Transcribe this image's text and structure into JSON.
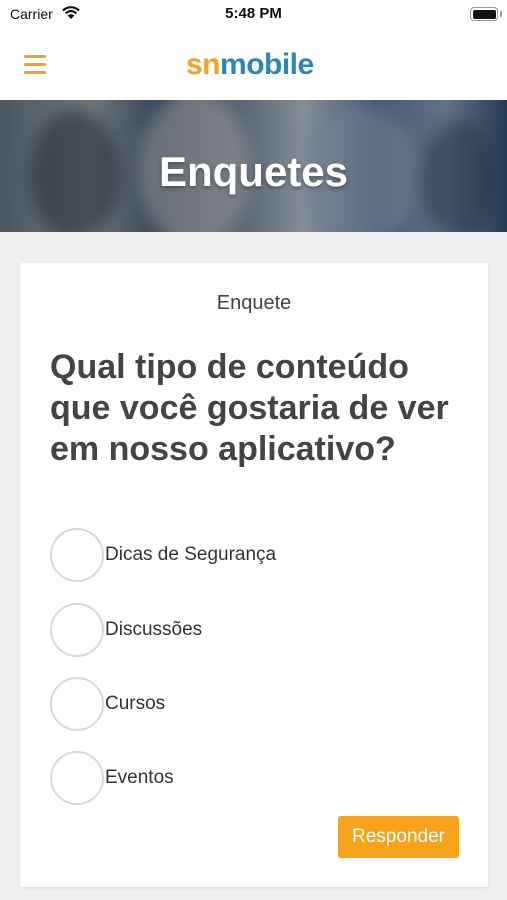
{
  "status_bar": {
    "carrier": "Carrier",
    "time": "5:48 PM",
    "icons": [
      "wifi-icon",
      "battery-icon"
    ]
  },
  "app_bar": {
    "menu_icon": "hamburger-menu-icon",
    "logo": {
      "part1": "sn",
      "part2": "mobile"
    },
    "colors": {
      "accent": "#f3a11f",
      "logo_blue": "#2a86bd"
    }
  },
  "hero": {
    "title": "Enquetes"
  },
  "poll": {
    "label": "Enquete",
    "question": "Qual tipo de conteúdo que você gostaria de ver em nosso aplicativo?",
    "options": [
      {
        "label": "Dicas de Segurança"
      },
      {
        "label": "Discussões"
      },
      {
        "label": "Cursos"
      },
      {
        "label": "Eventos"
      }
    ],
    "submit_label": "Responder"
  }
}
